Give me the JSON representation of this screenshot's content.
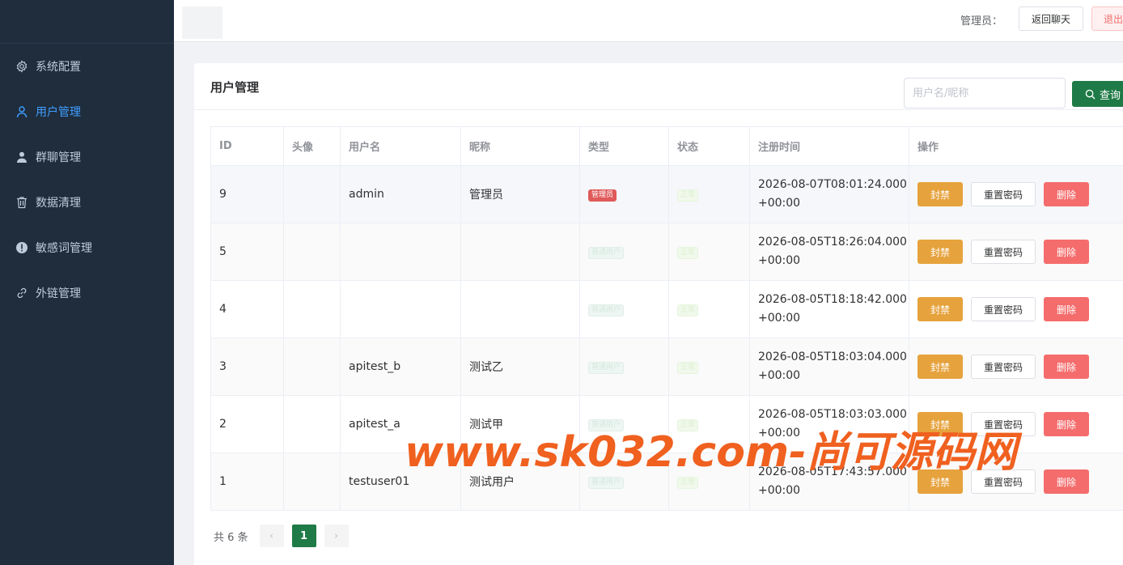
{
  "sidebar": {
    "items": [
      {
        "label": "系统配置",
        "icon": "gear-icon",
        "active": false
      },
      {
        "label": "用户管理",
        "icon": "user-icon",
        "active": true
      },
      {
        "label": "群聊管理",
        "icon": "group-icon",
        "active": false
      },
      {
        "label": "数据清理",
        "icon": "trash-icon",
        "active": false
      },
      {
        "label": "敏感词管理",
        "icon": "warning-icon",
        "active": false
      },
      {
        "label": "外链管理",
        "icon": "link-icon",
        "active": false
      }
    ]
  },
  "header": {
    "role_label": "管理员：",
    "back_label": "返回聊天",
    "logout_label": "退出"
  },
  "main": {
    "title": "用户管理",
    "search": {
      "placeholder": "用户名/昵称",
      "value": ""
    },
    "query_label": "查询",
    "columns": [
      "ID",
      "头像",
      "用户名",
      "昵称",
      "类型",
      "状态",
      "注册时间",
      "操作"
    ],
    "rows": [
      {
        "id": "9",
        "username": "admin",
        "nickname": "管理员",
        "type": "管理员",
        "status": "正常",
        "time1": "2026-08-07T08:01:24.000",
        "time2": "+00:00"
      },
      {
        "id": "5",
        "username": "",
        "nickname": "",
        "type": "普通用户",
        "status": "正常",
        "time1": "2026-08-05T18:26:04.000",
        "time2": "+00:00"
      },
      {
        "id": "4",
        "username": "",
        "nickname": "",
        "type": "普通用户",
        "status": "正常",
        "time1": "2026-08-05T18:18:42.000",
        "time2": "+00:00"
      },
      {
        "id": "3",
        "username": "apitest_b",
        "nickname": "测试乙",
        "type": "普通用户",
        "status": "正常",
        "time1": "2026-08-05T18:03:04.000",
        "time2": "+00:00"
      },
      {
        "id": "2",
        "username": "apitest_a",
        "nickname": "测试甲",
        "type": "普通用户",
        "status": "正常",
        "time1": "2026-08-05T18:03:03.000",
        "time2": "+00:00"
      },
      {
        "id": "1",
        "username": "testuser01",
        "nickname": "测试用户",
        "type": "普通用户",
        "status": "正常",
        "time1": "2026-08-05T17:43:57.000",
        "time2": "+00:00"
      }
    ],
    "actions": {
      "ban": "封禁",
      "reset": "重置密码",
      "delete": "删除"
    },
    "pagination": {
      "total_text": "共 6 条",
      "current_page": "1",
      "prev": "‹",
      "next": "›"
    }
  },
  "watermark": "www.sk032.com-尚可源码网",
  "colors": {
    "sidebar_bg": "#1f2d3d",
    "active": "#409eff",
    "primary": "#1e7a46",
    "warning": "#e6a23c",
    "danger": "#f56c6c"
  }
}
